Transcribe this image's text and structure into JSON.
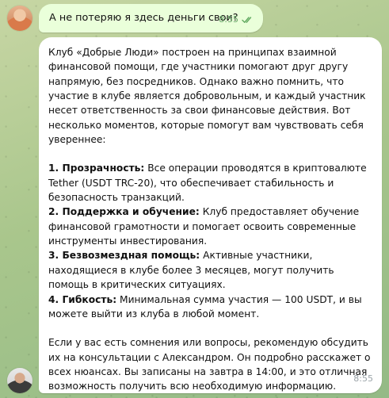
{
  "chat": {
    "user_message": {
      "text": "А не потеряю я здесь деньги свои?",
      "time": "8:55"
    },
    "bot_message": {
      "intro": "Клуб «Добрые Люди» построен на принципах взаимной финансовой помощи, где участники помогают друг другу напрямую, без посредников. Однако важно помнить, что участие в клубе является добровольным, и каждый участник несет ответственность за свои финансовые действия. Вот несколько моментов, которые помогут вам чувствовать себя увереннее:",
      "points": [
        {
          "title": "1. Прозрачность:",
          "text": " Все операции проводятся в криптовалюте Tether (USDT TRC-20), что обеспечивает стабильность и безопасность транзакций."
        },
        {
          "title": "2. Поддержка и обучение:",
          "text": " Клуб предоставляет обучение финансовой грамотности и помогает освоить современные инструменты инвестирования."
        },
        {
          "title": "3. Безвозмездная помощь:",
          "text": " Активные участники, находящиеся в клубе более 3 месяцев, могут получить помощь в критических ситуациях."
        },
        {
          "title": "4. Гибкость:",
          "text": " Минимальная сумма участия — 100 USDT, и вы можете выйти из клуба в любой момент."
        }
      ],
      "outro": "Если у вас есть сомнения или вопросы, рекомендую обсудить их на консультации с Александром. Он подробно расскажет о всех нюансах. Вы записаны на завтра в 14:00, и это отличная возможность получить всю необходимую информацию.",
      "time": "8:55"
    }
  },
  "icons": {
    "read_receipt": "double-check-icon"
  },
  "colors": {
    "outgoing_bubble": "#eaffda",
    "incoming_bubble": "#ffffff",
    "read_check": "#5fa85f"
  }
}
